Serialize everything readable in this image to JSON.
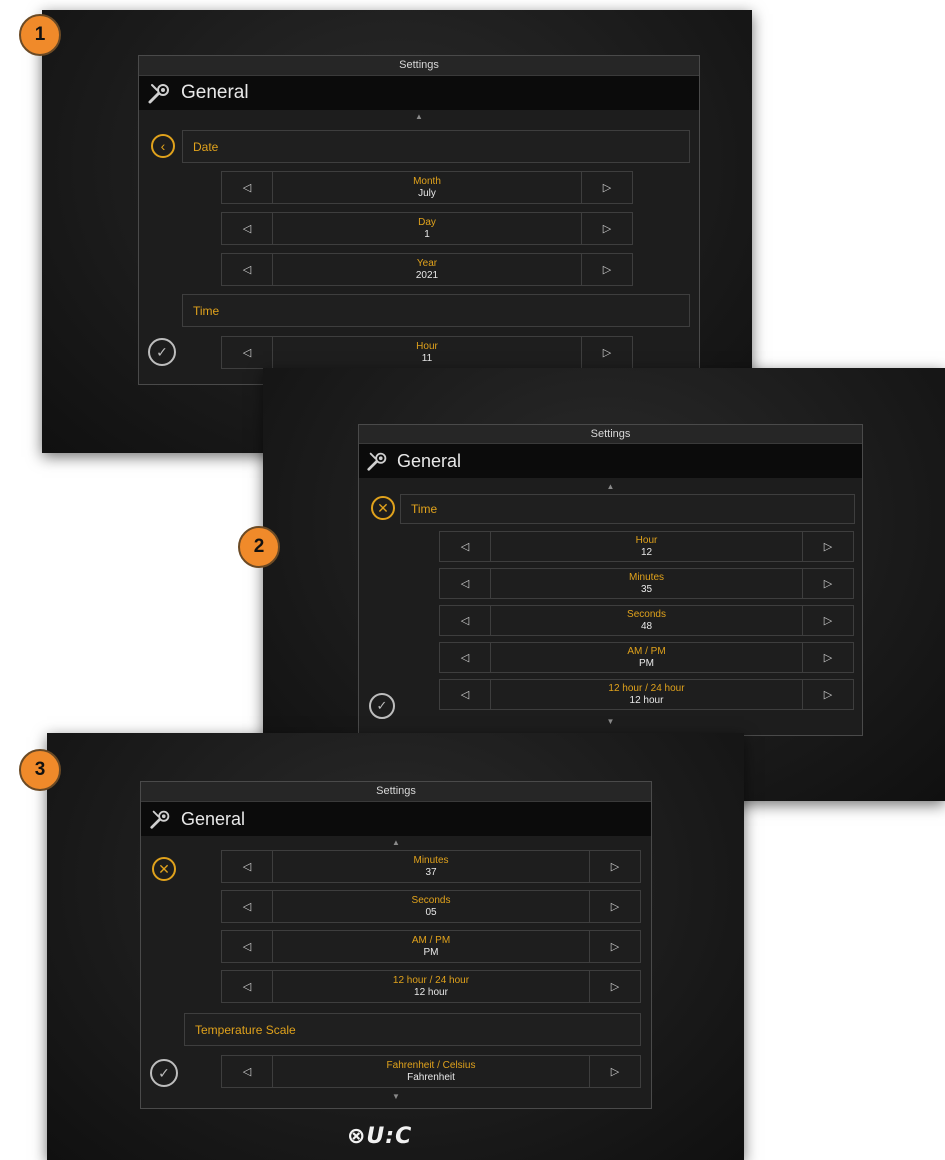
{
  "badges": [
    "1",
    "2",
    "3"
  ],
  "screens": [
    {
      "top_title": "Settings",
      "header": "General",
      "back_icon": "chevron-left-icon",
      "sections": [
        "Date",
        "Time"
      ],
      "rows": [
        {
          "label": "Month",
          "value": "July"
        },
        {
          "label": "Day",
          "value": "1"
        },
        {
          "label": "Year",
          "value": "2021"
        },
        {
          "label": "Hour",
          "value": "11"
        }
      ]
    },
    {
      "top_title": "Settings",
      "header": "General",
      "back_icon": "close-icon",
      "sections": [
        "Time"
      ],
      "rows": [
        {
          "label": "Hour",
          "value": "12"
        },
        {
          "label": "Minutes",
          "value": "35"
        },
        {
          "label": "Seconds",
          "value": "48"
        },
        {
          "label": "AM / PM",
          "value": "PM"
        },
        {
          "label": "12 hour / 24 hour",
          "value": "12 hour"
        }
      ]
    },
    {
      "top_title": "Settings",
      "header": "General",
      "back_icon": "close-icon",
      "sections": [
        "Temperature Scale"
      ],
      "rows": [
        {
          "label": "Minutes",
          "value": "37"
        },
        {
          "label": "Seconds",
          "value": "05"
        },
        {
          "label": "AM / PM",
          "value": "PM"
        },
        {
          "label": "12 hour / 24 hour",
          "value": "12 hour"
        },
        {
          "label": "Fahrenheit / Celsius",
          "value": "Fahrenheit"
        }
      ]
    }
  ],
  "glyphs": {
    "left_arrow": "◁",
    "right_arrow": "▷",
    "up": "▲",
    "down": "▼"
  },
  "logo": "⊗U:C",
  "colors": {
    "accent": "#e0a21c",
    "badge": "#f08a2a",
    "background": "#1a1a1a"
  }
}
